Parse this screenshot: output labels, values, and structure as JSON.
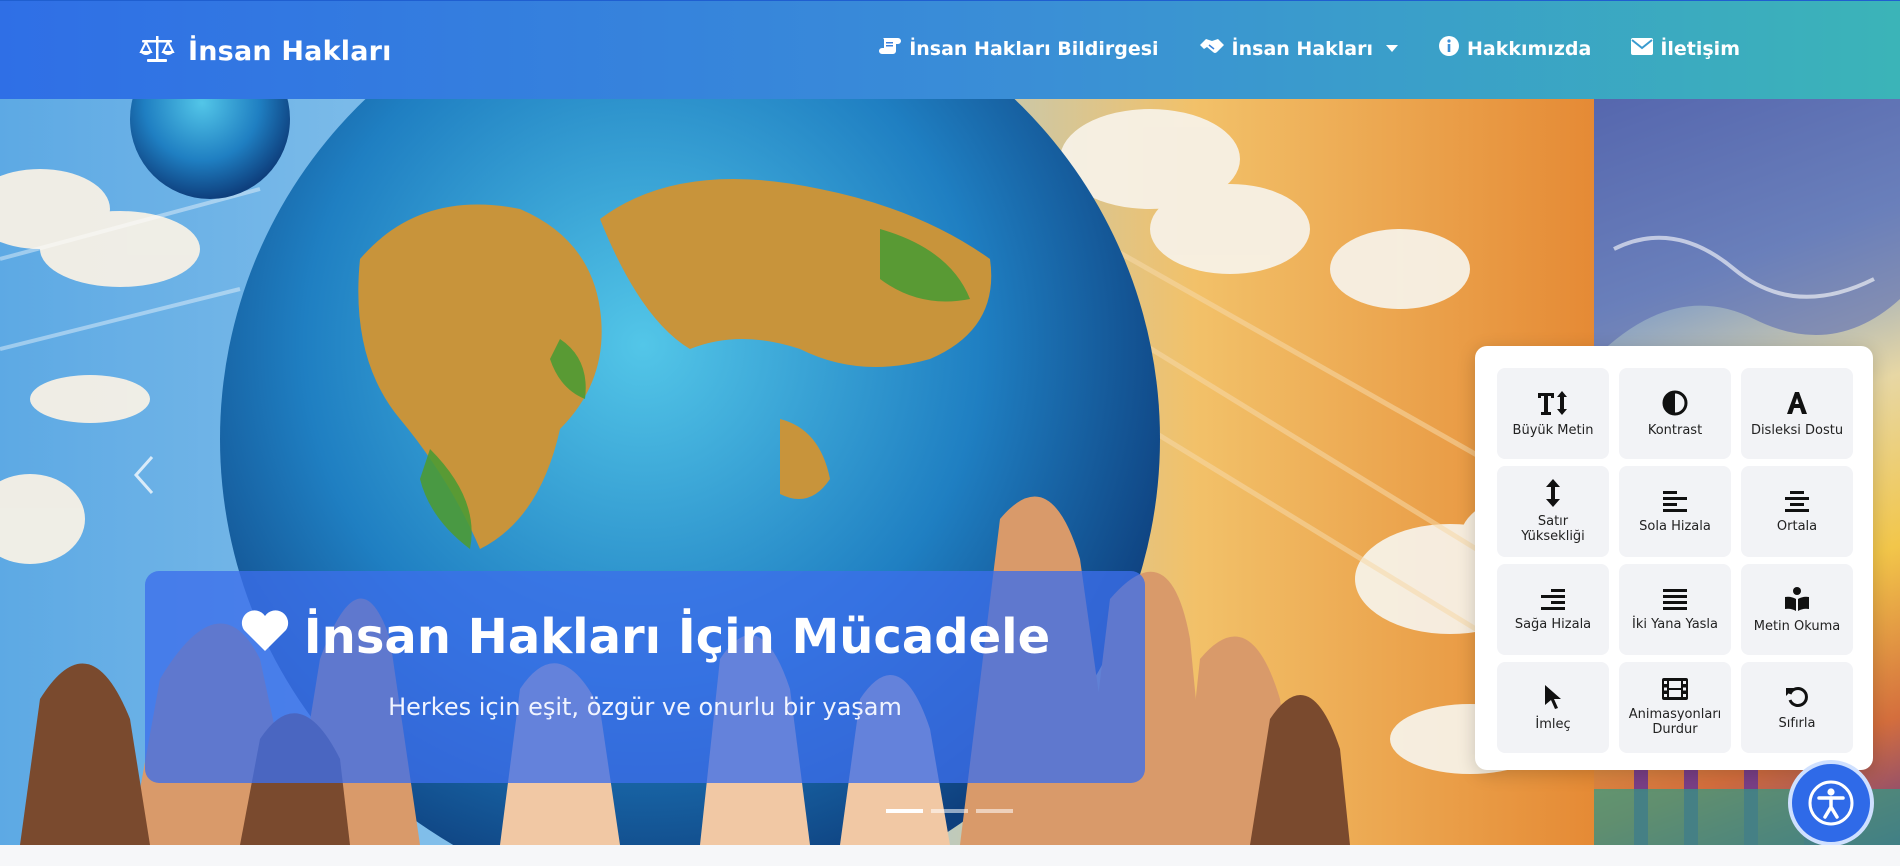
{
  "navbar": {
    "brand": "İnsan Hakları",
    "links": [
      {
        "label": "İnsan Hakları Bildirgesi",
        "icon": "scroll-icon"
      },
      {
        "label": "İnsan Hakları",
        "icon": "handshake-icon",
        "dropdown": true
      },
      {
        "label": "Hakkımızda",
        "icon": "info-circle-icon"
      },
      {
        "label": "İletişim",
        "icon": "envelope-icon"
      }
    ]
  },
  "hero": {
    "title": "İnsan Hakları İçin Mücadele",
    "subtitle": "Herkes için eşit, özgür ve onurlu bir yaşam",
    "active_slide": 1,
    "slide_count": 3
  },
  "accessibility": {
    "buttons": [
      {
        "label": "Büyük Metin",
        "icon": "text-height-icon"
      },
      {
        "label": "Kontrast",
        "icon": "contrast-icon"
      },
      {
        "label": "Disleksi Dostu",
        "icon": "font-icon"
      },
      {
        "label": "Satır Yüksekliği",
        "icon": "line-height-icon"
      },
      {
        "label": "Sola Hizala",
        "icon": "align-left-icon"
      },
      {
        "label": "Ortala",
        "icon": "align-center-icon"
      },
      {
        "label": "Sağa Hizala",
        "icon": "align-right-icon"
      },
      {
        "label": "İki Yana Yasla",
        "icon": "align-justify-icon"
      },
      {
        "label": "Metin Okuma",
        "icon": "book-reader-icon"
      },
      {
        "label": "İmleç",
        "icon": "cursor-icon"
      },
      {
        "label": "Animasyonları Durdur",
        "icon": "film-icon"
      },
      {
        "label": "Sıfırla",
        "icon": "reset-icon"
      }
    ]
  },
  "colors": {
    "navbar_start": "#2f6fe6",
    "navbar_end": "#3bb4b8",
    "caption_bg": "#3c6eeb",
    "fab": "#2f6ae8"
  }
}
